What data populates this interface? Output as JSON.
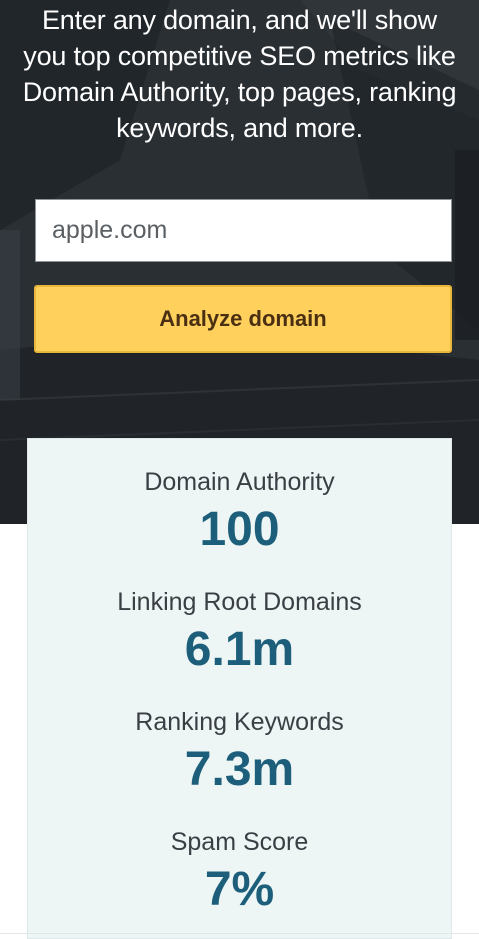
{
  "hero": {
    "intro_text": "Enter any domain, and we'll show you top competitive SEO metrics like Domain Authority, top pages, ranking keywords, and more."
  },
  "search": {
    "value": "apple.com",
    "button_label": "Analyze domain"
  },
  "metrics": [
    {
      "label": "Domain Authority",
      "value": "100"
    },
    {
      "label": "Linking Root Domains",
      "value": "6.1m"
    },
    {
      "label": "Ranking Keywords",
      "value": "7.3m"
    },
    {
      "label": "Spam Score",
      "value": "7%"
    }
  ],
  "colors": {
    "hero_background": "#2b3035",
    "button_fill": "#ffd15c",
    "button_text": "#4a2f12",
    "card_background": "#edf5f5",
    "metric_value": "#1d5f7a",
    "metric_label": "#3a3f44"
  }
}
